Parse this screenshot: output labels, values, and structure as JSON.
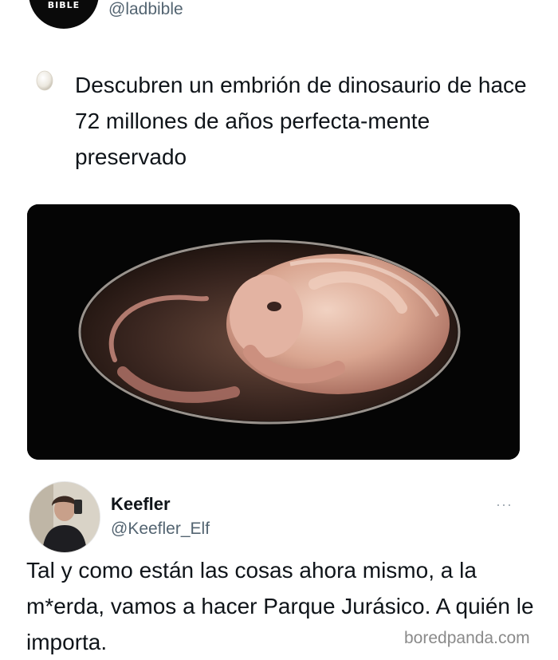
{
  "original_tweet": {
    "avatar_logo_text": "BIBLE",
    "handle": "@ladbible",
    "icon": "egg-icon",
    "text": "Descubren un embrión de dinosaurio de hace 72 millones de años perfecta-mente preservado",
    "media": "dinosaur-embryo-image"
  },
  "reply": {
    "name": "Keefler",
    "handle": "@Keefler_Elf",
    "more_label": "···",
    "text": "Tal y como están las cosas ahora mismo, a la m*erda, vamos a hacer Parque Jurásico. A quién le importa."
  },
  "watermark": "boredpanda.com",
  "colors": {
    "text": "#0f1419",
    "secondary_text": "#536471",
    "media_background": "#050505"
  }
}
